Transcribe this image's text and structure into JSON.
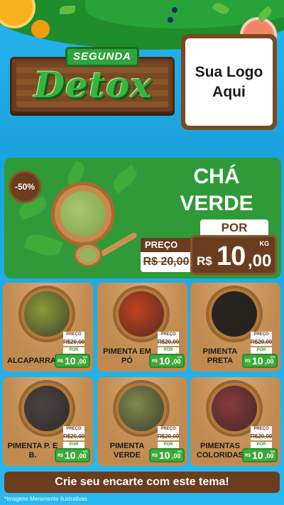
{
  "header": {
    "title_small": "SEGUNDA",
    "title_big": "Detox",
    "logo_line1": "Sua Logo",
    "logo_line2": "Aqui"
  },
  "feature": {
    "discount": "-50%",
    "name_line1": "CHÁ",
    "name_line2": "VERDE",
    "preco_label": "PREÇO",
    "old_price": "R$ 20,00",
    "por_label": "POR",
    "currency": "R$",
    "price_int": "10",
    "price_dec": ",00",
    "unit": "KG"
  },
  "products": [
    {
      "name": "ALCAPARRAS",
      "color": "#8a9a3a",
      "preco": "PREÇO",
      "old": "R$20,00",
      "por": "POR",
      "currency": "R$",
      "int": "10",
      "dec": ",00",
      "unit": "KG"
    },
    {
      "name": "PIMENTA EM PÓ",
      "color": "#c4421e",
      "preco": "PREÇO",
      "old": "R$20,00",
      "por": "POR",
      "currency": "R$",
      "int": "10",
      "dec": ",00",
      "unit": "KG"
    },
    {
      "name": "PIMENTA PRETA",
      "color": "#2a2420",
      "preco": "PREÇO",
      "old": "R$20,00",
      "por": "POR",
      "currency": "R$",
      "int": "10",
      "dec": ",00",
      "unit": "KG"
    },
    {
      "name": "PIMENTA P. E B.",
      "color": "#4a4440",
      "preco": "PREÇO",
      "old": "R$20,00",
      "por": "POR",
      "currency": "R$",
      "int": "10",
      "dec": ",00",
      "unit": "KG"
    },
    {
      "name": "PIMENTA VERDE",
      "color": "#7f8a4a",
      "preco": "PREÇO",
      "old": "R$20,00",
      "por": "POR",
      "currency": "R$",
      "int": "10",
      "dec": ",00",
      "unit": "KG"
    },
    {
      "name": "PIMENTAS COLORIDAS",
      "color": "#8a3a3a",
      "preco": "PREÇO",
      "old": "R$20,00",
      "por": "POR",
      "currency": "R$",
      "int": "10",
      "dec": ",00",
      "unit": "KG"
    }
  ],
  "cta": "Crie seu encarte com este tema!",
  "disclaimer": "*Imagens Meramente Ilustrativas",
  "colors": {
    "brown": "#6b3d1f",
    "green": "#2f9a37",
    "sky": "#1ba9e6"
  }
}
